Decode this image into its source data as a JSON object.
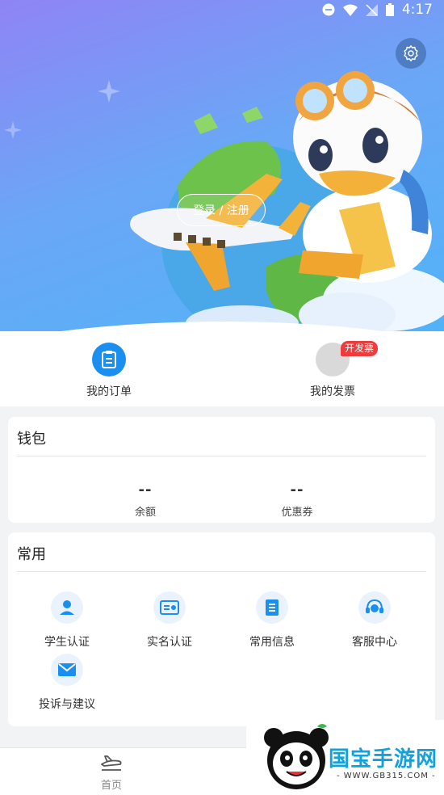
{
  "status_bar": {
    "time": "4:17"
  },
  "header": {
    "login_label": "登录 / 注册"
  },
  "shortcuts": [
    {
      "label": "我的订单",
      "icon": "clipboard-icon"
    },
    {
      "label": "我的发票",
      "icon": "invoice-icon",
      "badge": "开发票"
    }
  ],
  "wallet": {
    "title": "钱包",
    "items": [
      {
        "value": "--",
        "label": "余额"
      },
      {
        "value": "--",
        "label": "优惠券"
      }
    ]
  },
  "common": {
    "title": "常用",
    "items": [
      {
        "label": "学生认证",
        "icon": "student-icon"
      },
      {
        "label": "实名认证",
        "icon": "id-card-icon"
      },
      {
        "label": "常用信息",
        "icon": "info-list-icon"
      },
      {
        "label": "客服中心",
        "icon": "headset-icon"
      },
      {
        "label": "投诉与建议",
        "icon": "mail-icon"
      }
    ]
  },
  "bottom_nav": {
    "home_label": "首页"
  },
  "watermark": {
    "text": "国宝手游网",
    "url": "- WWW.GB315.COM -"
  },
  "colors": {
    "accent": "#1a8ff0",
    "badge": "#ef3b3b",
    "icon_bg": "#eaf3fd"
  }
}
